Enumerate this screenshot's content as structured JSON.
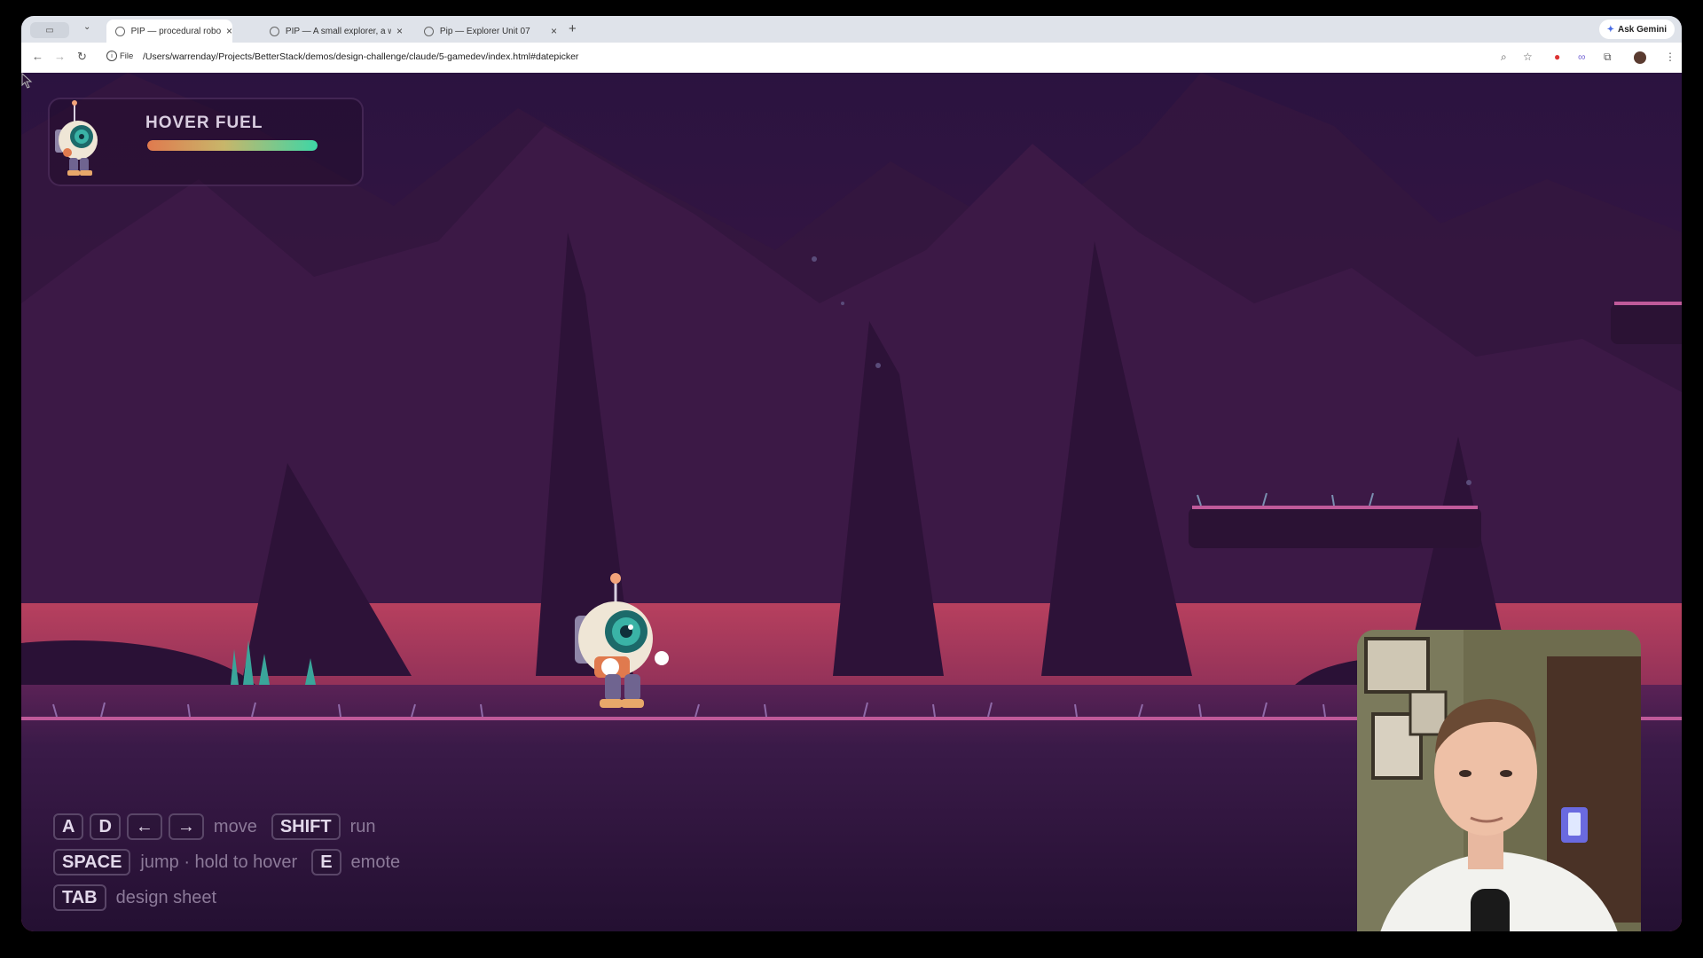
{
  "browser": {
    "tabs": [
      {
        "title": "PIP — procedural robot explo",
        "active": true
      },
      {
        "title": "PIP — A small explorer, a wid",
        "active": false
      },
      {
        "title": "Pip — Explorer Unit 07",
        "active": false
      }
    ],
    "new_tab": "+",
    "ask_gemini": "Ask Gemini",
    "protocol_chip": "File",
    "url": "/Users/warrenday/Projects/BetterStack/demos/design-challenge/claude/5-gamedev/index.html#datepicker",
    "icons": [
      "back-icon",
      "forward-icon",
      "reload-icon",
      "info-icon",
      "zoom-icon",
      "star-icon",
      "extension-icon",
      "link-icon",
      "puzzle-icon",
      "profile-avatar",
      "menu-icon"
    ]
  },
  "hud": {
    "title": "HOVER FUEL",
    "fuel_level": 1.0,
    "fuel_gradient": [
      "#e07a4e",
      "#c8b66a",
      "#3ed6a6"
    ]
  },
  "controls": {
    "row1": {
      "keys": [
        "A",
        "D",
        "←",
        "→"
      ],
      "label": "move",
      "key2": "SHIFT",
      "label2": "run"
    },
    "row2": {
      "key": "SPACE",
      "label": "jump · hold to hover",
      "key2": "E",
      "label2": "emote"
    },
    "row3": {
      "key": "TAB",
      "label": "design sheet"
    }
  },
  "colors": {
    "sky": "#2e1440",
    "horizon": "#c0455f",
    "ground": "#3a1a48",
    "grass_line": "#c05a9a",
    "accent_teal": "#3ed6a6"
  },
  "overlay": {
    "partial_text": "s"
  }
}
